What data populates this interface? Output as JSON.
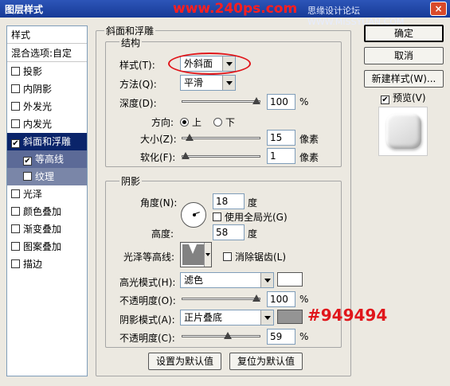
{
  "window": {
    "title": "图层样式",
    "watermark": "www.240ps.com",
    "watermark_sub": "思缘设计论坛 WWW.MISSYUAN.COM",
    "close_label": "×"
  },
  "style_list": {
    "header": "样式",
    "blending": "混合选项:自定",
    "items": [
      {
        "label": "投影",
        "checked": false
      },
      {
        "label": "内阴影",
        "checked": false
      },
      {
        "label": "外发光",
        "checked": false
      },
      {
        "label": "内发光",
        "checked": false
      },
      {
        "label": "斜面和浮雕",
        "checked": true
      },
      {
        "label": "等高线",
        "checked": true
      },
      {
        "label": "纹理",
        "checked": false
      },
      {
        "label": "光泽",
        "checked": false
      },
      {
        "label": "颜色叠加",
        "checked": false
      },
      {
        "label": "渐变叠加",
        "checked": false
      },
      {
        "label": "图案叠加",
        "checked": false
      },
      {
        "label": "描边",
        "checked": false
      }
    ],
    "check_mark": "✔"
  },
  "bevel": {
    "group_title": "斜面和浮雕",
    "structure": {
      "title": "结构",
      "style_label": "样式(T):",
      "style_value": "外斜面",
      "technique_label": "方法(Q):",
      "technique_value": "平滑",
      "depth_label": "深度(D):",
      "depth_value": "100",
      "depth_level": 1.0,
      "percent": "%",
      "direction_label": "方向:",
      "direction_up": "上",
      "direction_down": "下",
      "size_label": "大小(Z):",
      "size_value": "15",
      "size_level": 0.06,
      "soften_label": "软化(F):",
      "soften_value": "1",
      "soften_level": 0.0,
      "pixels": "像素"
    },
    "shading": {
      "title": "阴影",
      "angle_label": "角度(N):",
      "angle_value": "18",
      "degree": "度",
      "global_light": "使用全局光(G)",
      "altitude_label": "高度:",
      "altitude_value": "58",
      "gloss_label": "光泽等高线:",
      "antialias": "消除锯齿(L)",
      "highlight_mode_label": "高光模式(H):",
      "highlight_mode_value": "滤色",
      "highlight_color": "#ffffff",
      "highlight_opacity_label": "不透明度(O):",
      "highlight_opacity_value": "100",
      "highlight_opacity_level": 1.0,
      "shadow_mode_label": "阴影模式(A):",
      "shadow_mode_value": "正片叠底",
      "shadow_color": "#949494",
      "shadow_opacity_label": "不透明度(C):",
      "shadow_opacity_value": "59",
      "shadow_opacity_level": 0.59
    },
    "make_default": "设置为默认值",
    "reset_default": "复位为默认值"
  },
  "buttons": {
    "ok": "确定",
    "cancel": "取消",
    "new_style": "新建样式(W)...",
    "preview": "预览(V)"
  },
  "annotation": "#949494"
}
